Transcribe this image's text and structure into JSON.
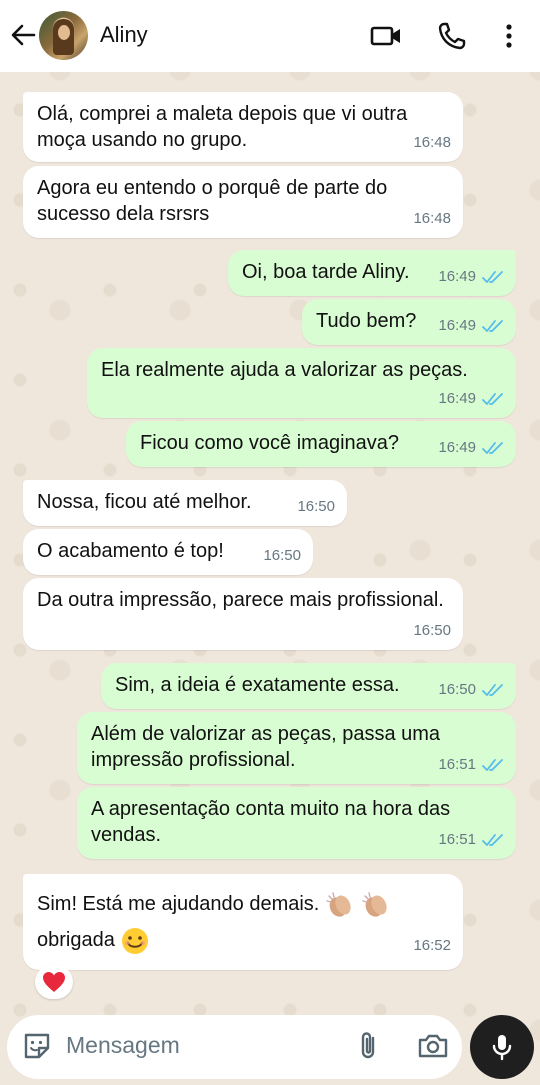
{
  "header": {
    "contact_name": "Aliny",
    "icons": [
      "back-arrow-icon",
      "video-call-icon",
      "voice-call-icon",
      "more-options-icon"
    ]
  },
  "messages": [
    {
      "direction": "in",
      "text": "Olá, comprei a maleta depois que vi outra moça usando no grupo.",
      "time": "16:48"
    },
    {
      "direction": "in",
      "text": "Agora eu entendo o porquê de parte do sucesso dela rsrsrs",
      "time": "16:48"
    },
    {
      "direction": "out",
      "text": "Oi, boa tarde Aliny.",
      "time": "16:49",
      "status": "read"
    },
    {
      "direction": "out",
      "text": "Tudo bem?",
      "time": "16:49",
      "status": "read"
    },
    {
      "direction": "out",
      "text": "Ela realmente ajuda a valorizar as peças.",
      "time": "16:49",
      "status": "read"
    },
    {
      "direction": "out",
      "text": "Ficou como você imaginava?",
      "time": "16:49",
      "status": "read"
    },
    {
      "direction": "in",
      "text": "Nossa, ficou até melhor.",
      "time": "16:50"
    },
    {
      "direction": "in",
      "text": "O acabamento é top!",
      "time": "16:50"
    },
    {
      "direction": "in",
      "text": "Da outra impressão, parece mais profissional.",
      "time": "16:50"
    },
    {
      "direction": "out",
      "text": "Sim, a ideia é exatamente essa.",
      "time": "16:50",
      "status": "read"
    },
    {
      "direction": "out",
      "text": "Além de valorizar as peças, passa uma impressão profissional.",
      "time": "16:51",
      "status": "read"
    },
    {
      "direction": "out",
      "text": "A apresentação conta muito na hora das vendas.",
      "time": "16:51",
      "status": "read"
    },
    {
      "direction": "in",
      "text_line1": "Sim! Está me ajudando demais.",
      "text_line2": "obrigada",
      "emojis": [
        "clapping-hands-icon",
        "clapping-hands-icon",
        "smiling-face-icon"
      ],
      "time": "16:52",
      "reaction": "red-heart-icon"
    }
  ],
  "composer": {
    "placeholder": "Mensagem",
    "icons": [
      "sticker-icon",
      "attach-icon",
      "camera-icon",
      "microphone-icon"
    ]
  },
  "colors": {
    "incoming_bubble": "#ffffff",
    "outgoing_bubble": "#d9fdd3",
    "read_ticks": "#53bdeb",
    "timestamp": "#667781"
  }
}
